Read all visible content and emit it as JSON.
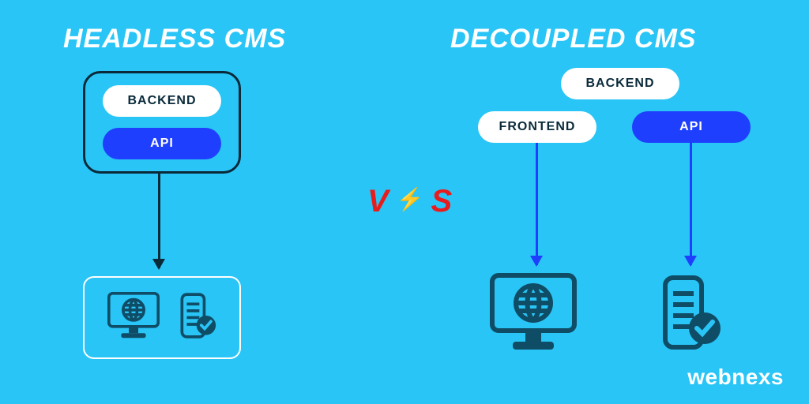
{
  "titles": {
    "left": "HEADLESS CMS",
    "right": "DECOUPLED CMS"
  },
  "headless": {
    "backend_label": "BACKEND",
    "api_label": "API"
  },
  "decoupled": {
    "backend_label": "BACKEND",
    "frontend_label": "FRONTEND",
    "api_label": "API"
  },
  "vs_label": "VS",
  "brand": "webnexs",
  "colors": {
    "background": "#29c5f6",
    "accent_blue": "#1f3fff",
    "dark": "#0f4c66",
    "vs_red": "#e81c1c",
    "white": "#ffffff"
  },
  "icons": {
    "desktop_globe": "desktop-globe-icon",
    "mobile_check": "mobile-check-icon",
    "lightning": "lightning-icon"
  }
}
